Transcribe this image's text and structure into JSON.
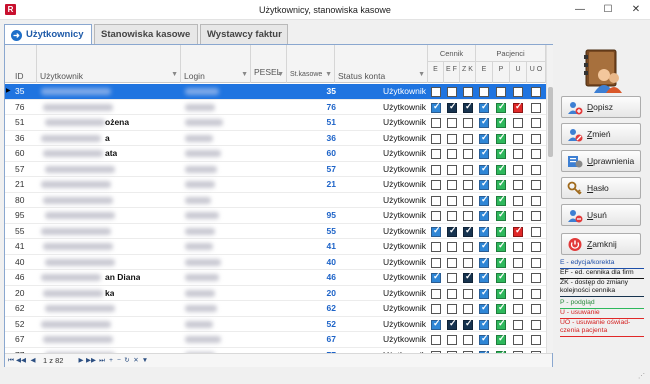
{
  "window": {
    "title": "Użytkownicy, stanowiska kasowe",
    "app_badge": "R",
    "minimize": "—",
    "maximize": "☐",
    "close": "✕"
  },
  "tabs": [
    {
      "label": "Użytkownicy",
      "active": true
    },
    {
      "label": "Stanowiska kasowe",
      "active": false
    },
    {
      "label": "Wystawcy faktur",
      "active": false
    }
  ],
  "grid": {
    "columns": {
      "id": "ID",
      "user": "Użytkownik",
      "login": "Login",
      "pesel": "PESEL",
      "kasa": "St.kasowe",
      "status": "Status konta"
    },
    "groups": {
      "cennik": "Cennik",
      "pacjenci": "Pacjenci"
    },
    "sub": {
      "cennik": [
        "E",
        "E F",
        "Z K"
      ],
      "pacjenci": [
        "E",
        "P",
        "U",
        "U O"
      ]
    },
    "rows": [
      {
        "id": "35",
        "name": "",
        "kasa": "35",
        "status": "Użytkownik",
        "c": [
          "b",
          "b",
          "b"
        ],
        "p": [
          "b",
          "b",
          "b",
          "b"
        ],
        "sel": true
      },
      {
        "id": "76",
        "name": "",
        "kasa": "76",
        "status": "Użytkownik",
        "c": [
          "B",
          "D",
          "D"
        ],
        "p": [
          "B",
          "G",
          "R",
          ""
        ]
      },
      {
        "id": "51",
        "name": "ożena",
        "kasa": "51",
        "status": "Użytkownik",
        "c": [
          "",
          "",
          ""
        ],
        "p": [
          "B",
          "G",
          "",
          ""
        ]
      },
      {
        "id": "36",
        "name": "a",
        "kasa": "36",
        "status": "Użytkownik",
        "c": [
          "",
          "",
          ""
        ],
        "p": [
          "B",
          "G",
          "",
          ""
        ]
      },
      {
        "id": "60",
        "name": "ata",
        "kasa": "60",
        "status": "Użytkownik",
        "c": [
          "",
          "",
          ""
        ],
        "p": [
          "B",
          "G",
          "",
          ""
        ]
      },
      {
        "id": "57",
        "name": "",
        "kasa": "57",
        "status": "Użytkownik",
        "c": [
          "",
          "",
          ""
        ],
        "p": [
          "B",
          "G",
          "",
          ""
        ]
      },
      {
        "id": "21",
        "name": "",
        "kasa": "21",
        "status": "Użytkownik",
        "c": [
          "",
          "",
          ""
        ],
        "p": [
          "B",
          "G",
          "",
          ""
        ]
      },
      {
        "id": "80",
        "name": "",
        "kasa": "",
        "status": "Użytkownik",
        "c": [
          "",
          "",
          ""
        ],
        "p": [
          "B",
          "G",
          "",
          ""
        ]
      },
      {
        "id": "95",
        "name": "",
        "kasa": "95",
        "status": "Użytkownik",
        "c": [
          "",
          "",
          ""
        ],
        "p": [
          "B",
          "G",
          "",
          ""
        ]
      },
      {
        "id": "55",
        "name": "",
        "kasa": "55",
        "status": "Użytkownik",
        "c": [
          "B",
          "D",
          "D"
        ],
        "p": [
          "B",
          "G",
          "R",
          ""
        ]
      },
      {
        "id": "41",
        "name": "",
        "kasa": "41",
        "status": "Użytkownik",
        "c": [
          "",
          "",
          ""
        ],
        "p": [
          "B",
          "G",
          "",
          ""
        ]
      },
      {
        "id": "40",
        "name": "",
        "kasa": "40",
        "status": "Użytkownik",
        "c": [
          "",
          "",
          ""
        ],
        "p": [
          "B",
          "G",
          "",
          ""
        ]
      },
      {
        "id": "46",
        "name": "an Diana",
        "kasa": "46",
        "status": "Użytkownik",
        "c": [
          "B",
          "",
          "D"
        ],
        "p": [
          "B",
          "G",
          "",
          ""
        ]
      },
      {
        "id": "20",
        "name": "ka",
        "kasa": "20",
        "status": "Użytkownik",
        "c": [
          "",
          "",
          ""
        ],
        "p": [
          "B",
          "G",
          "",
          ""
        ]
      },
      {
        "id": "62",
        "name": "",
        "kasa": "62",
        "status": "Użytkownik",
        "c": [
          "",
          "",
          ""
        ],
        "p": [
          "B",
          "G",
          "",
          ""
        ]
      },
      {
        "id": "52",
        "name": "",
        "kasa": "52",
        "status": "Użytkownik",
        "c": [
          "B",
          "D",
          "D"
        ],
        "p": [
          "B",
          "G",
          "",
          ""
        ]
      },
      {
        "id": "67",
        "name": "",
        "kasa": "67",
        "status": "Użytkownik",
        "c": [
          "",
          "",
          ""
        ],
        "p": [
          "B",
          "G",
          "",
          ""
        ]
      },
      {
        "id": "77",
        "name": "",
        "kasa": "77",
        "status": "Użytkownik",
        "c": [
          "",
          "",
          ""
        ],
        "p": [
          "B",
          "G",
          "",
          ""
        ]
      }
    ]
  },
  "navigator": {
    "record_text": "1 z 82"
  },
  "actions": [
    {
      "label": "Dopisz",
      "underline": "D",
      "rest": "opisz",
      "icon": "add-user-icon"
    },
    {
      "label": "Zmień",
      "underline": "Z",
      "rest": "mień",
      "icon": "edit-user-icon"
    },
    {
      "label": "Uprawnienia",
      "underline": "U",
      "rest": "prawnienia",
      "icon": "permissions-icon"
    },
    {
      "label": "Hasło",
      "underline": "H",
      "rest": "asło",
      "icon": "key-icon"
    },
    {
      "label": "Usuń",
      "underline": "U",
      "rest": "suń",
      "icon": "delete-user-icon"
    },
    {
      "label": "Zamknij",
      "underline": "Z",
      "rest": "amknij",
      "icon": "power-icon"
    }
  ],
  "legend": {
    "l1": "E - edycja/korekta",
    "l2": "EF - ed. cennika dla firm",
    "l3": "ZK - dostęp do zmiany kolejności cennika",
    "l4": "P - podgląd",
    "l5": "U - usuwanie",
    "l6": "UO - usuwanie oświad-czenia pacjenta"
  },
  "colors": {
    "selection": "#1f74e0",
    "check_blue": "#2f86d6",
    "check_dark": "#17334f",
    "check_green": "#2eb85c",
    "check_red": "#e02828"
  }
}
